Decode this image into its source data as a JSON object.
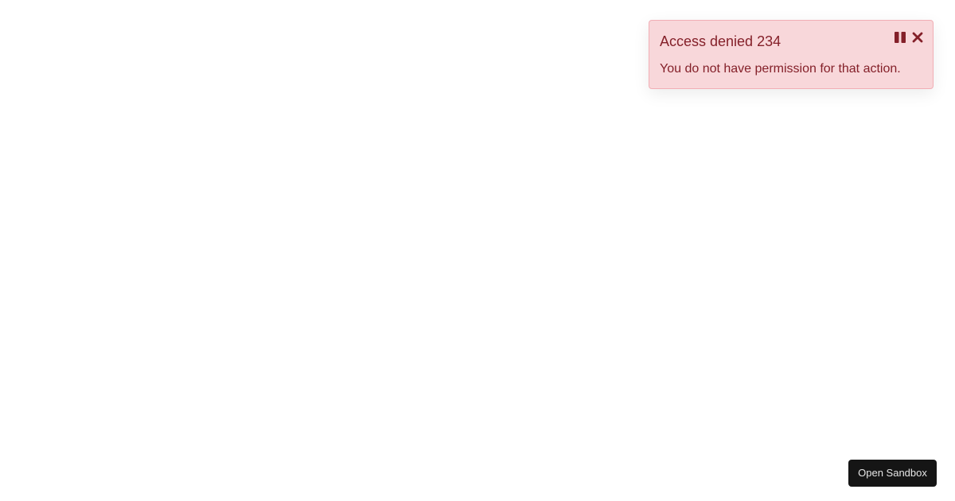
{
  "toast": {
    "title": "Access denied 234",
    "message": "You do not have permission for that action.",
    "variant": "danger",
    "colors": {
      "background": "#f8d7da",
      "border": "#f1aeb5",
      "text": "#842029"
    },
    "controls": {
      "pause_icon": "pause-icon",
      "close_icon": "close-icon"
    }
  },
  "footer": {
    "sandbox_button_label": "Open Sandbox",
    "sandbox_button_color": "#151515"
  }
}
